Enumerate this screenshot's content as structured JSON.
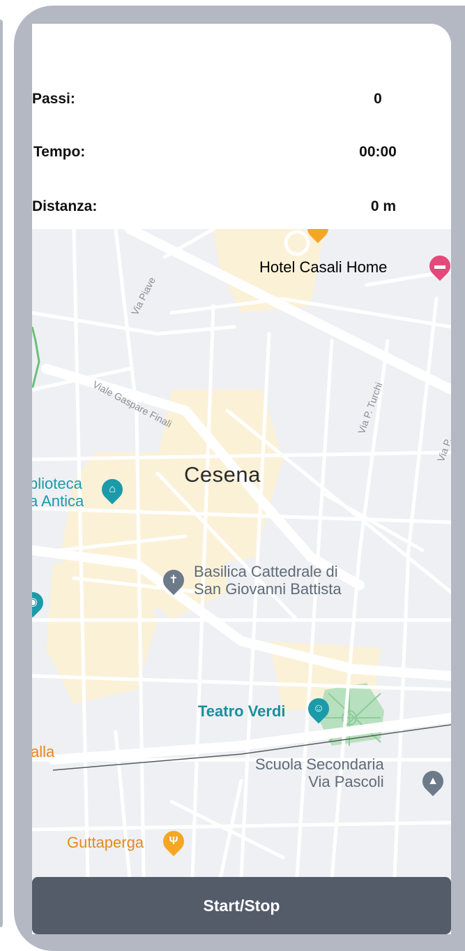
{
  "stats": {
    "steps": {
      "label": "Passi:",
      "value": "0"
    },
    "time": {
      "label": "Tempo:",
      "value": "00:00"
    },
    "distance": {
      "label": "Distanza:",
      "value": "0 m"
    }
  },
  "map": {
    "city": "Cesena",
    "streets": {
      "via_piave": "Via Piave",
      "viale_gaspare_finali": "Viale Gaspare Finali",
      "via_p_turchi": "Via P. Turchi",
      "via_p_partial": "Via P..."
    },
    "pois": {
      "hotel": {
        "label": "Hotel Casali Home",
        "icon": "bed-icon",
        "color": "#e5487b"
      },
      "library": {
        "label": "blioteca\na Antica",
        "icon": "museum-icon",
        "color": "#1b9aaa"
      },
      "basilica": {
        "label": "Basilica Cattedrale di\nSan Giovanni Battista",
        "icon": "cross-icon",
        "color": "#6c7a89"
      },
      "teatro": {
        "label": "Teatro Verdi",
        "icon": "theater-icon",
        "color": "#1b9aaa"
      },
      "scuola": {
        "label": "Scuola Secondaria\nVia Pascoli",
        "icon": "graduation-cap-icon",
        "color": "#6c7a89"
      },
      "guttaperga": {
        "label": "Guttaperga",
        "icon": "restaurant-icon",
        "color": "#f5a623"
      },
      "alla": {
        "label": "alla"
      },
      "photo": {
        "icon": "camera-icon",
        "color": "#1b9aaa"
      }
    }
  },
  "actions": {
    "start_stop": "Start/Stop"
  }
}
